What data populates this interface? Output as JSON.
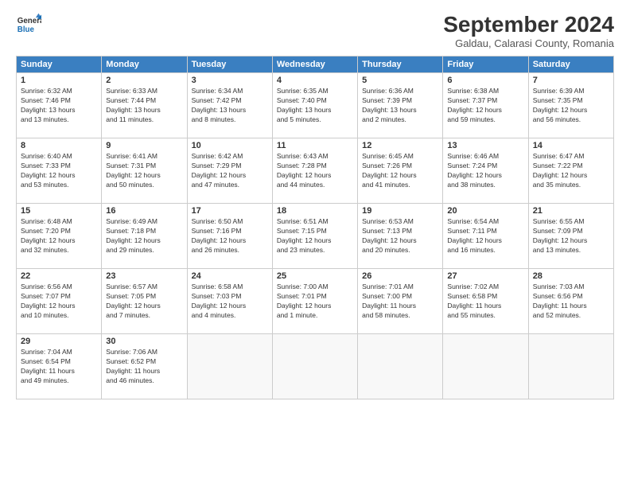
{
  "header": {
    "logo_line1": "General",
    "logo_line2": "Blue",
    "month_title": "September 2024",
    "location": "Galdau, Calarasi County, Romania"
  },
  "weekdays": [
    "Sunday",
    "Monday",
    "Tuesday",
    "Wednesday",
    "Thursday",
    "Friday",
    "Saturday"
  ],
  "weeks": [
    [
      {
        "day": "1",
        "info": "Sunrise: 6:32 AM\nSunset: 7:46 PM\nDaylight: 13 hours\nand 13 minutes."
      },
      {
        "day": "2",
        "info": "Sunrise: 6:33 AM\nSunset: 7:44 PM\nDaylight: 13 hours\nand 11 minutes."
      },
      {
        "day": "3",
        "info": "Sunrise: 6:34 AM\nSunset: 7:42 PM\nDaylight: 13 hours\nand 8 minutes."
      },
      {
        "day": "4",
        "info": "Sunrise: 6:35 AM\nSunset: 7:40 PM\nDaylight: 13 hours\nand 5 minutes."
      },
      {
        "day": "5",
        "info": "Sunrise: 6:36 AM\nSunset: 7:39 PM\nDaylight: 13 hours\nand 2 minutes."
      },
      {
        "day": "6",
        "info": "Sunrise: 6:38 AM\nSunset: 7:37 PM\nDaylight: 12 hours\nand 59 minutes."
      },
      {
        "day": "7",
        "info": "Sunrise: 6:39 AM\nSunset: 7:35 PM\nDaylight: 12 hours\nand 56 minutes."
      }
    ],
    [
      {
        "day": "8",
        "info": "Sunrise: 6:40 AM\nSunset: 7:33 PM\nDaylight: 12 hours\nand 53 minutes."
      },
      {
        "day": "9",
        "info": "Sunrise: 6:41 AM\nSunset: 7:31 PM\nDaylight: 12 hours\nand 50 minutes."
      },
      {
        "day": "10",
        "info": "Sunrise: 6:42 AM\nSunset: 7:29 PM\nDaylight: 12 hours\nand 47 minutes."
      },
      {
        "day": "11",
        "info": "Sunrise: 6:43 AM\nSunset: 7:28 PM\nDaylight: 12 hours\nand 44 minutes."
      },
      {
        "day": "12",
        "info": "Sunrise: 6:45 AM\nSunset: 7:26 PM\nDaylight: 12 hours\nand 41 minutes."
      },
      {
        "day": "13",
        "info": "Sunrise: 6:46 AM\nSunset: 7:24 PM\nDaylight: 12 hours\nand 38 minutes."
      },
      {
        "day": "14",
        "info": "Sunrise: 6:47 AM\nSunset: 7:22 PM\nDaylight: 12 hours\nand 35 minutes."
      }
    ],
    [
      {
        "day": "15",
        "info": "Sunrise: 6:48 AM\nSunset: 7:20 PM\nDaylight: 12 hours\nand 32 minutes."
      },
      {
        "day": "16",
        "info": "Sunrise: 6:49 AM\nSunset: 7:18 PM\nDaylight: 12 hours\nand 29 minutes."
      },
      {
        "day": "17",
        "info": "Sunrise: 6:50 AM\nSunset: 7:16 PM\nDaylight: 12 hours\nand 26 minutes."
      },
      {
        "day": "18",
        "info": "Sunrise: 6:51 AM\nSunset: 7:15 PM\nDaylight: 12 hours\nand 23 minutes."
      },
      {
        "day": "19",
        "info": "Sunrise: 6:53 AM\nSunset: 7:13 PM\nDaylight: 12 hours\nand 20 minutes."
      },
      {
        "day": "20",
        "info": "Sunrise: 6:54 AM\nSunset: 7:11 PM\nDaylight: 12 hours\nand 16 minutes."
      },
      {
        "day": "21",
        "info": "Sunrise: 6:55 AM\nSunset: 7:09 PM\nDaylight: 12 hours\nand 13 minutes."
      }
    ],
    [
      {
        "day": "22",
        "info": "Sunrise: 6:56 AM\nSunset: 7:07 PM\nDaylight: 12 hours\nand 10 minutes."
      },
      {
        "day": "23",
        "info": "Sunrise: 6:57 AM\nSunset: 7:05 PM\nDaylight: 12 hours\nand 7 minutes."
      },
      {
        "day": "24",
        "info": "Sunrise: 6:58 AM\nSunset: 7:03 PM\nDaylight: 12 hours\nand 4 minutes."
      },
      {
        "day": "25",
        "info": "Sunrise: 7:00 AM\nSunset: 7:01 PM\nDaylight: 12 hours\nand 1 minute."
      },
      {
        "day": "26",
        "info": "Sunrise: 7:01 AM\nSunset: 7:00 PM\nDaylight: 11 hours\nand 58 minutes."
      },
      {
        "day": "27",
        "info": "Sunrise: 7:02 AM\nSunset: 6:58 PM\nDaylight: 11 hours\nand 55 minutes."
      },
      {
        "day": "28",
        "info": "Sunrise: 7:03 AM\nSunset: 6:56 PM\nDaylight: 11 hours\nand 52 minutes."
      }
    ],
    [
      {
        "day": "29",
        "info": "Sunrise: 7:04 AM\nSunset: 6:54 PM\nDaylight: 11 hours\nand 49 minutes."
      },
      {
        "day": "30",
        "info": "Sunrise: 7:06 AM\nSunset: 6:52 PM\nDaylight: 11 hours\nand 46 minutes."
      },
      {
        "day": "",
        "info": ""
      },
      {
        "day": "",
        "info": ""
      },
      {
        "day": "",
        "info": ""
      },
      {
        "day": "",
        "info": ""
      },
      {
        "day": "",
        "info": ""
      }
    ]
  ]
}
